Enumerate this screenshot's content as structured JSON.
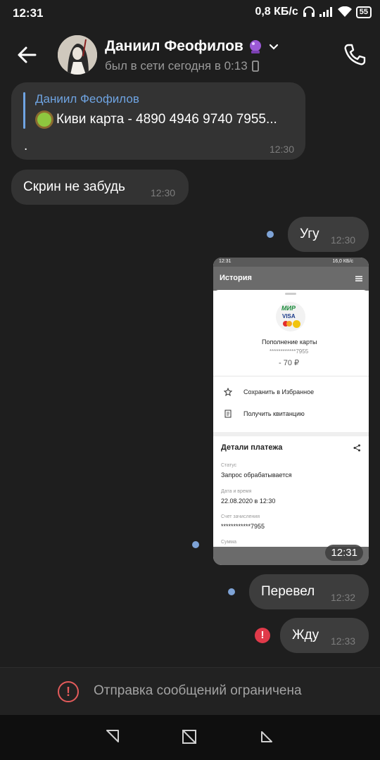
{
  "status_bar": {
    "time": "12:31",
    "speed": "0,8 КБ/с",
    "battery": "55"
  },
  "header": {
    "name": "Даниил Феофилов",
    "status": "был в сети сегодня в 0:13"
  },
  "messages": {
    "forward": {
      "author": "Даниил Феофилов",
      "text": "Киви карта - 4890 4946 9740 7955...",
      "body": ".",
      "time": "12:30"
    },
    "screen": {
      "text": "Скрин не забудь",
      "time": "12:30"
    },
    "ugu": {
      "text": "Угу",
      "time": "12:30"
    },
    "photo": {
      "time": "12:31"
    },
    "pereval": {
      "text": "Перевел",
      "time": "12:32"
    },
    "zhdu": {
      "text": "Жду",
      "time": "12:33"
    }
  },
  "photo": {
    "status_time": "12:31",
    "status_right": "16,0 КБ/с",
    "title": "История",
    "card_title": "Пополнение карты",
    "card_mask": "************7955",
    "amount": "- 70 ₽",
    "save_fav": "Сохранить в Избранное",
    "get_receipt": "Получить квитанцию",
    "details_title": "Детали платежа",
    "status_label": "Статус",
    "status_value": "Запрос обрабатывается",
    "date_label": "Дата и время",
    "date_value": "22.08.2020 в 12:30",
    "account_label": "Счет зачисления",
    "account_value": "************7955",
    "sum_label": "Сумма",
    "brand_mir": "МИР",
    "brand_visa": "VISA"
  },
  "restriction": {
    "text": "Отправка сообщений ограничена"
  },
  "colors": {
    "link_blue": "#6fa4e2",
    "error_red": "#e35b5b",
    "bubble": "#333333"
  }
}
